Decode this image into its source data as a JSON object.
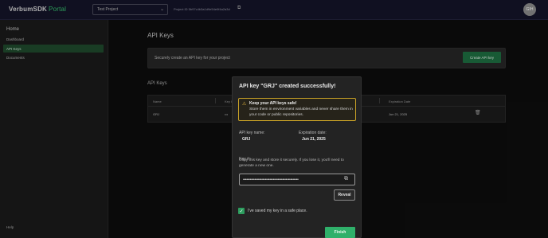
{
  "topbar": {
    "logo": "VerbumSDK",
    "logo_suffix": "Portal",
    "project_select": "Test Project",
    "project_id": "Project ID 5b97c4b3a1d9e54e0f4a2a3d",
    "avatar_initials": "GIH"
  },
  "sidebar": {
    "title": "Home",
    "items": [
      {
        "label": "Dashboard"
      },
      {
        "label": "API Keys"
      },
      {
        "label": "Documents"
      }
    ],
    "help": "Help"
  },
  "main": {
    "title": "API Keys",
    "create_text": "Securely create an API key for your project",
    "create_button": "Create API key",
    "section_title": "API Keys",
    "table": {
      "headers": [
        "Name",
        "Key ID",
        "Expiration Date"
      ],
      "row": {
        "name": "GRJ",
        "key": "•••",
        "expiration": "Jun 21, 2025"
      }
    }
  },
  "modal": {
    "title": "API key \"GRJ\" created successfully!",
    "warning_title": "Keep your API keys safe!",
    "warning_body": "Store them in environment variables and never share them in your code or public repositories.",
    "name_label": "API key name:",
    "name_value": "GRJ",
    "expiration_label": "Expiration date:",
    "expiration_value": "Jun 21, 2025",
    "key_label": "Key #:",
    "key_desc": "Copy this key and store it securely. If you lose it, you'll need to generate a new one.",
    "key_masked": "••••••••••••••••••••••••••••••••••••••••••••••••",
    "reveal_button": "Reveal",
    "checkbox_label": "I've saved my key in a safe place.",
    "finish_button": "Finish"
  },
  "colors": {
    "accent": "#2fb06a",
    "warning": "#c9a227",
    "topbar": "#141429"
  }
}
